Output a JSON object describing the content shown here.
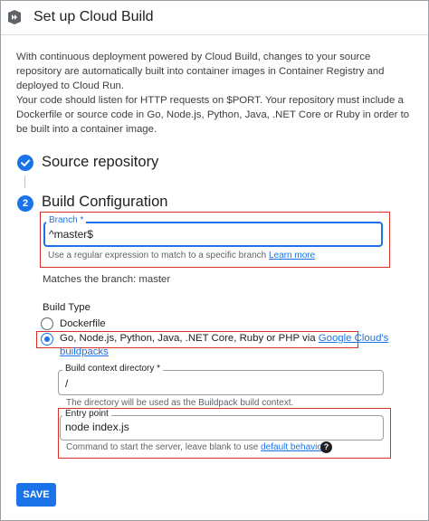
{
  "header": {
    "title": "Set up Cloud Build",
    "icon": "cloud-run-logo-icon"
  },
  "intro": {
    "p1": "With continuous deployment powered by Cloud Build, changes to your source repository are automatically built into container images in Container Registry and deployed to Cloud Run.",
    "p2": "Your code should listen for HTTP requests on $PORT. Your repository must include a Dockerfile or source code in Go, Node.js, Python, Java, .NET Core or Ruby in order to be built into a container image."
  },
  "steps": {
    "source": {
      "title": "Source repository",
      "status": "completed"
    },
    "build": {
      "number": "2",
      "title": "Build Configuration"
    }
  },
  "branch": {
    "label": "Branch *",
    "value": "^master$",
    "helper": "Use a regular expression to match to a specific branch",
    "helper_link": "Learn more",
    "matches": "Matches the branch: master"
  },
  "build_type": {
    "heading": "Build Type",
    "options": [
      {
        "label": "Dockerfile",
        "checked": false
      },
      {
        "label": "Go, Node.js, Python, Java, .NET Core, Ruby or PHP via",
        "link": "Google Cloud's",
        "link2": "buildpacks",
        "checked": true
      }
    ]
  },
  "context_dir": {
    "label": "Build context directory *",
    "value": "/",
    "helper": "The directory will be used as the Buildpack build context."
  },
  "entry_point": {
    "label": "Entry point",
    "value": "node index.js",
    "helper": "Command to start the server, leave blank to use",
    "helper_link": "default behaviour"
  },
  "save_label": "SAVE",
  "colors": {
    "accent": "#1a73e8",
    "highlight": "#d93025"
  }
}
